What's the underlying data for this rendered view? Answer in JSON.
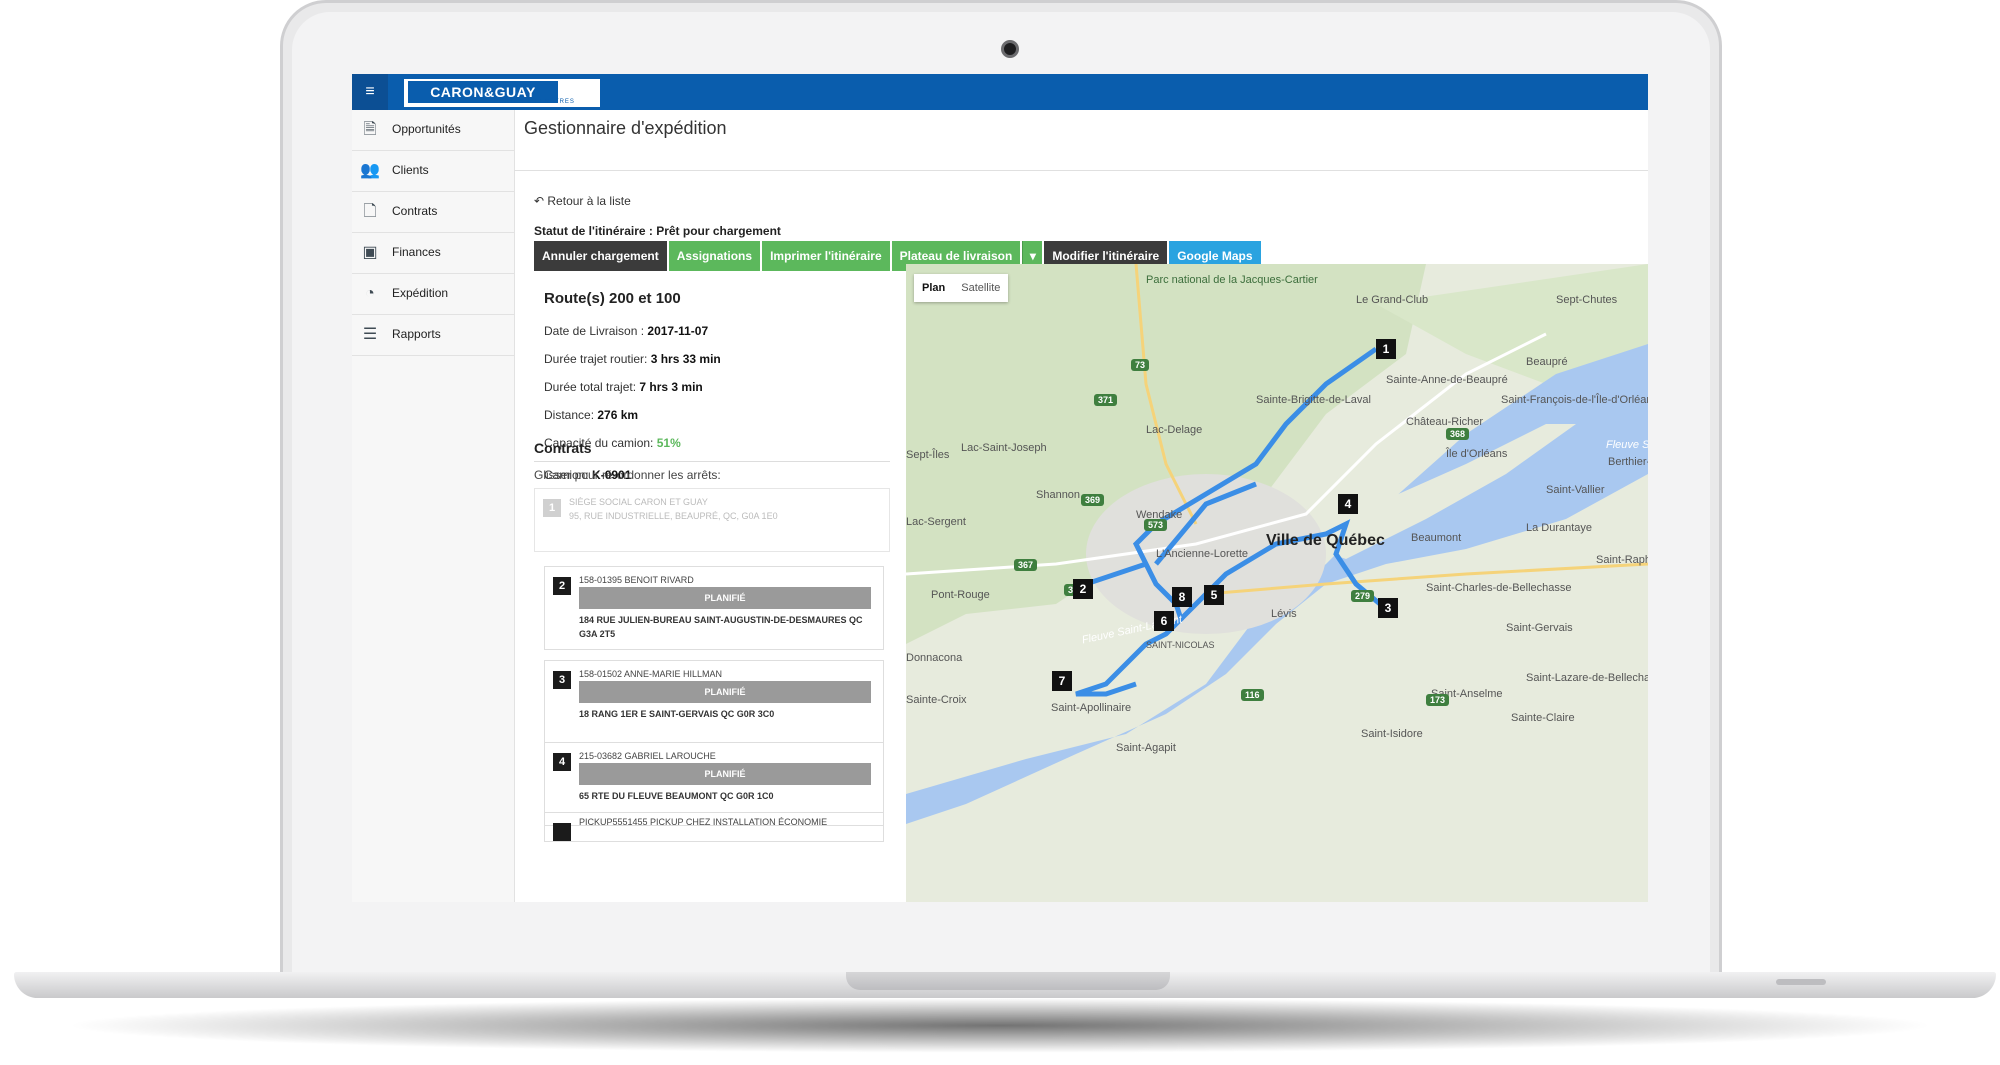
{
  "app": {
    "logo_text": "CARON&GUAY",
    "logo_sub": "PORTES & FENÊTRES",
    "menu_icon": "hamburger-icon"
  },
  "sidebar": {
    "items": [
      {
        "label": "Opportunités",
        "icon": "document-icon"
      },
      {
        "label": "Clients",
        "icon": "users-icon"
      },
      {
        "label": "Contrats",
        "icon": "file-icon"
      },
      {
        "label": "Finances",
        "icon": "briefcase-icon"
      },
      {
        "label": "Expédition",
        "icon": "gauge-icon"
      },
      {
        "label": "Rapports",
        "icon": "list-icon"
      }
    ]
  },
  "page": {
    "title": "Gestionnaire d'expédition",
    "back_link": "Retour à la liste",
    "status": "Statut de l'itinéraire : Prêt pour chargement"
  },
  "actions": {
    "cancel_loading": "Annuler chargement",
    "assignments": "Assignations",
    "print": "Imprimer l'itinéraire",
    "delivery_tray": "Plateau de livraison",
    "edit": "Modifier l'itinéraire",
    "google_maps": "Google Maps"
  },
  "route": {
    "title": "Route(s) 200 et 100",
    "delivery_date_label": "Date de Livraison : ",
    "delivery_date": "2017-11-07",
    "road_duration_label": "Durée trajet routier: ",
    "road_duration": "3 hrs 33 min",
    "total_duration_label": "Durée total trajet: ",
    "total_duration": "7 hrs 3 min",
    "distance_label": "Distance: ",
    "distance": "276 km",
    "capacity_label": "Capacité du camion: ",
    "capacity": "51%",
    "truck_label": "Camion: ",
    "truck": "K-0901"
  },
  "contracts": {
    "heading": "Contrats",
    "drag_hint": "Glisser pour ré-ordonner les arrêts:",
    "origin": {
      "number": "1",
      "line1": "SIÈGE SOCIAL CARON ET GUAY",
      "line2": "95, RUE INDUSTRIELLE, BEAUPRÉ, QC, G0A 1E0"
    },
    "stops": [
      {
        "number": "2",
        "id": "158-01395 BENOIT RIVARD",
        "status": "PLANIFIÉ",
        "address": "184 RUE JULIEN-BUREAU SAINT-AUGUSTIN-DE-DESMAURES QC G3A 2T5"
      },
      {
        "number": "3",
        "id": "158-01502 ANNE-MARIE HILLMAN",
        "status": "PLANIFIÉ",
        "address": "18 RANG 1ER E SAINT-GERVAIS QC G0R 3C0"
      },
      {
        "number": "4",
        "id": "215-03682 GABRIEL LAROUCHE",
        "status": "PLANIFIÉ",
        "address": "65 RTE DU FLEUVE BEAUMONT QC G0R 1C0"
      }
    ],
    "partial_row": "PICKUP5551455 PICKUP CHEZ INSTALLATION ÉCONOMIE"
  },
  "map": {
    "plan_label": "Plan",
    "satellite_label": "Satellite",
    "places": {
      "park": "Parc national de la Jacques-Cartier",
      "le_grand_club": "Le Grand-Club",
      "sept_chutes": "Sept-Chutes",
      "beaupre": "Beaupré",
      "sainte_anne": "Sainte-Anne-de-Beaupré",
      "saint_francois": "Saint-François-de-l'Île-d'Orléans",
      "sainte_brigitte": "Sainte-Brigitte-de-Laval",
      "chateau_richer": "Château-Richer",
      "lac_delage": "Lac-Delage",
      "sept_iles": "Sept-Îles",
      "lac_saint_joseph": "Lac-Saint-Joseph",
      "ile_orleans": "Île d'Orléans",
      "fleuve_top": "Fleuve Sai",
      "berthier": "Berthier-",
      "shannon": "Shannon",
      "saint_vallier": "Saint-Vallier",
      "wendake": "Wendake",
      "lac_sergent": "Lac-Sergent",
      "la_durantaye": "La Durantaye",
      "beaumont": "Beaumont",
      "ville_de_quebec": "Ville de Québec",
      "ancienne_lorette": "L'Ancienne-Lorette",
      "saint_raphael": "Saint-Raph",
      "pont_rouge": "Pont-Rouge",
      "saint_charles": "Saint-Charles-de-Bellechasse",
      "fleuve_saint_laurent": "Fleuve Saint-Laurent",
      "saint_gervais": "Saint-Gervais",
      "saint_nicolas": "SAINT-NICOLAS",
      "donnacona": "Donnacona",
      "levis": "Lévis",
      "saint_lazare": "Saint-Lazare-de-Bellechas",
      "sainte_croix": "Sainte-Croix",
      "saint_apollinaire": "Saint-Apollinaire",
      "saint_anselme": "Saint-Anselme",
      "sainte_claire": "Sainte-Claire",
      "saint_isidore": "Saint-Isidore",
      "saint_agapit": "Saint-Agapit"
    },
    "pins": [
      "1",
      "2",
      "3",
      "4",
      "5",
      "6",
      "7",
      "8"
    ],
    "route_color": "#3b8ee6",
    "water_color": "#a9c8f0"
  }
}
